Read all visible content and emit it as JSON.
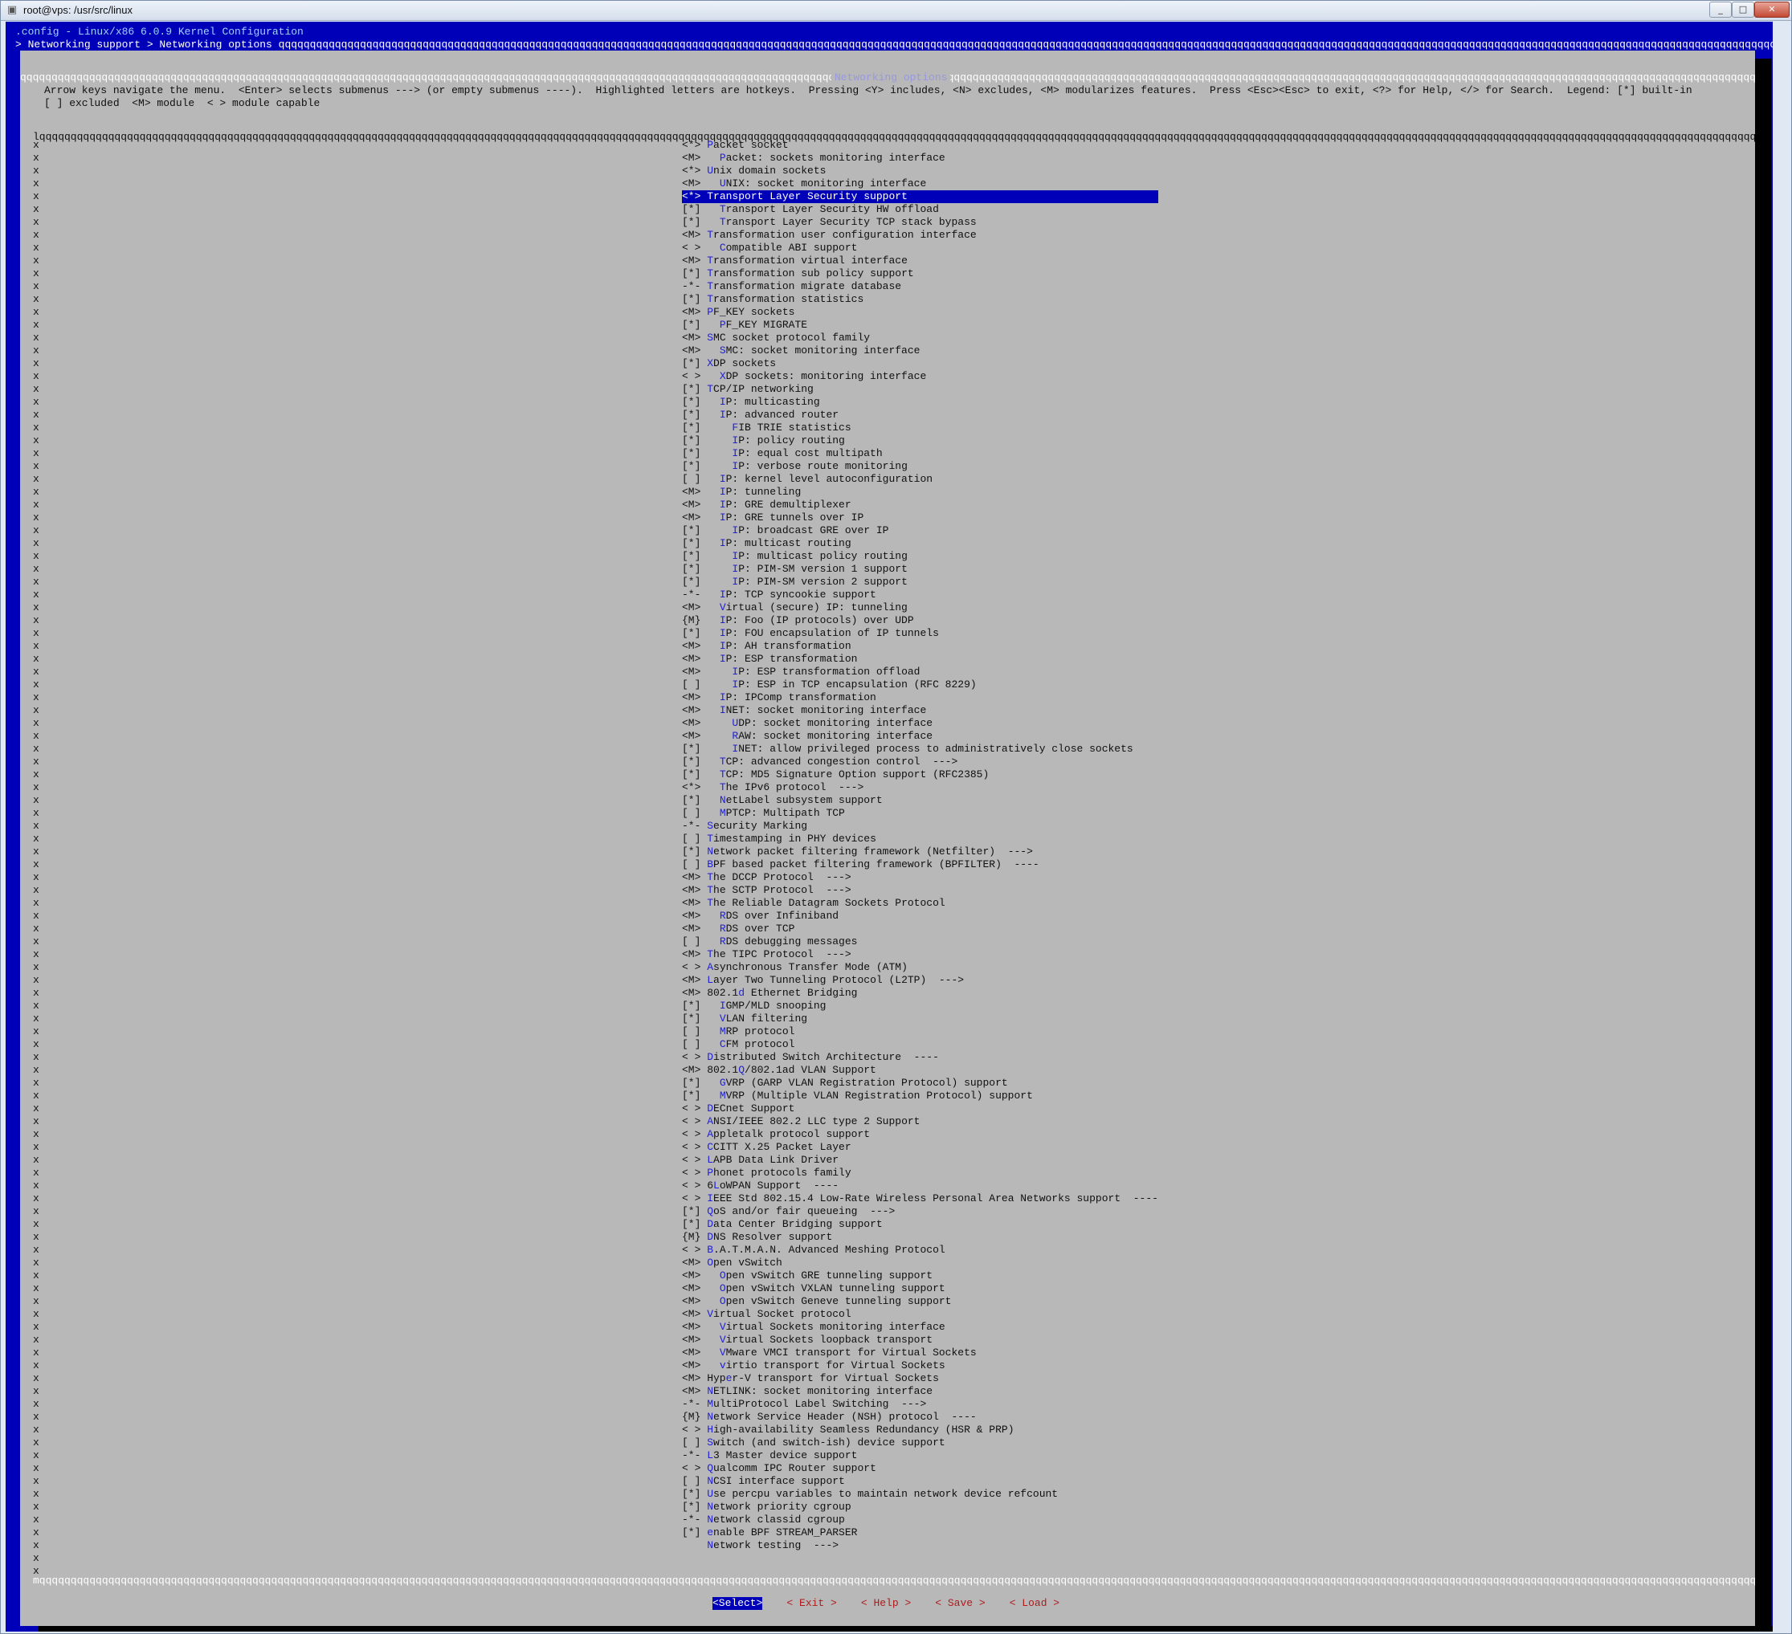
{
  "window": {
    "title": "root@vps: /usr/src/linux",
    "controls": {
      "minimize": "_",
      "maximize": "□",
      "close": "✕"
    }
  },
  "terminal": {
    "header": ".config - Linux/x86 6.0.9 Kernel Configuration",
    "breadcrumb": "> Networking support > Networking options qqqqqqqqqqqqqqqqqqqqqqqqqqqqqqqqqqqqqqqqqqqqqqqqqqqqqqqqqqqqqqqqqqqqqqqqqqqqqqqqqqqqqqqqqqqqqqqqqqqqqqqqqqqqqqqqqqqqqqqqqqqqqqqqqqqqqqqqqqqqqqqqqqqqqqqqqqqqqqqqqqqqqqqqqqqqqqqqqqqqqqqqqqqqqqqqqqqqqqqqqqqqqqqqqqqqqqqqqqqqqqqqqqqqqqqqqqqqqqqqqqqqqqq"
  },
  "dialog": {
    "title": "Networking options",
    "help": "Arrow keys navigate the menu.  <Enter> selects submenus ---> (or empty submenus ----).  Highlighted letters are hotkeys.  Pressing <Y> includes, <N> excludes, <M> modularizes features.  Press <Esc><Esc> to exit, <?> for Help, </> for Search.  Legend: [*] built-in\n[ ] excluded  <M> module  < > module capable",
    "items": [
      {
        "prefix": "<*> ",
        "hot": "P",
        "rest": "acket socket"
      },
      {
        "prefix": "<M>   ",
        "hot": "P",
        "rest": "acket: sockets monitoring interface"
      },
      {
        "prefix": "<*> ",
        "hot": "U",
        "rest": "nix domain sockets"
      },
      {
        "prefix": "<M>   ",
        "hot": "U",
        "rest": "NIX: socket monitoring interface"
      },
      {
        "prefix": "<*> ",
        "hot": "T",
        "rest": "ransport Layer Security support",
        "selected": true
      },
      {
        "prefix": "[*]   ",
        "hot": "T",
        "rest": "ransport Layer Security HW offload"
      },
      {
        "prefix": "[*]   ",
        "hot": "T",
        "rest": "ransport Layer Security TCP stack bypass"
      },
      {
        "prefix": "<M> ",
        "hot": "T",
        "rest": "ransformation user configuration interface"
      },
      {
        "prefix": "< >   ",
        "hot": "C",
        "rest": "ompatible ABI support"
      },
      {
        "prefix": "<M> ",
        "hot": "T",
        "rest": "ransformation virtual interface"
      },
      {
        "prefix": "[*] ",
        "hot": "T",
        "rest": "ransformation sub policy support"
      },
      {
        "prefix": "-*- ",
        "hot": "T",
        "rest": "ransformation migrate database"
      },
      {
        "prefix": "[*] ",
        "hot": "T",
        "rest": "ransformation statistics"
      },
      {
        "prefix": "<M> ",
        "hot": "P",
        "rest": "F_KEY sockets"
      },
      {
        "prefix": "[*]   ",
        "hot": "P",
        "rest": "F_KEY MIGRATE"
      },
      {
        "prefix": "<M> ",
        "hot": "S",
        "rest": "MC socket protocol family"
      },
      {
        "prefix": "<M>   ",
        "hot": "S",
        "rest": "MC: socket monitoring interface"
      },
      {
        "prefix": "[*] ",
        "hot": "X",
        "rest": "DP sockets"
      },
      {
        "prefix": "< >   ",
        "hot": "X",
        "rest": "DP sockets: monitoring interface"
      },
      {
        "prefix": "[*] ",
        "hot": "T",
        "rest": "CP/IP networking"
      },
      {
        "prefix": "[*]   ",
        "hot": "I",
        "rest": "P: multicasting"
      },
      {
        "prefix": "[*]   ",
        "hot": "I",
        "rest": "P: advanced router"
      },
      {
        "prefix": "[*]     ",
        "hot": "F",
        "rest": "IB TRIE statistics"
      },
      {
        "prefix": "[*]     ",
        "hot": "I",
        "rest": "P: policy routing"
      },
      {
        "prefix": "[*]     ",
        "hot": "I",
        "rest": "P: equal cost multipath"
      },
      {
        "prefix": "[*]     ",
        "hot": "I",
        "rest": "P: verbose route monitoring"
      },
      {
        "prefix": "[ ]   ",
        "hot": "I",
        "rest": "P: kernel level autoconfiguration"
      },
      {
        "prefix": "<M>   ",
        "hot": "I",
        "rest": "P: tunneling"
      },
      {
        "prefix": "<M>   ",
        "hot": "I",
        "rest": "P: GRE demultiplexer"
      },
      {
        "prefix": "<M>   ",
        "hot": "I",
        "rest": "P: GRE tunnels over IP"
      },
      {
        "prefix": "[*]     ",
        "hot": "I",
        "rest": "P: broadcast GRE over IP"
      },
      {
        "prefix": "[*]   ",
        "hot": "I",
        "rest": "P: multicast routing"
      },
      {
        "prefix": "[*]     ",
        "hot": "I",
        "rest": "P: multicast policy routing"
      },
      {
        "prefix": "[*]     ",
        "hot": "I",
        "rest": "P: PIM-SM version 1 support"
      },
      {
        "prefix": "[*]     ",
        "hot": "I",
        "rest": "P: PIM-SM version 2 support"
      },
      {
        "prefix": "-*-   ",
        "hot": "I",
        "rest": "P: TCP syncookie support"
      },
      {
        "prefix": "<M>   ",
        "hot": "V",
        "rest": "irtual (secure) IP: tunneling"
      },
      {
        "prefix": "{M}   ",
        "hot": "I",
        "rest": "P: Foo (IP protocols) over UDP"
      },
      {
        "prefix": "[*]   ",
        "hot": "I",
        "rest": "P: FOU encapsulation of IP tunnels"
      },
      {
        "prefix": "<M>   ",
        "hot": "I",
        "rest": "P: AH transformation"
      },
      {
        "prefix": "<M>   ",
        "hot": "I",
        "rest": "P: ESP transformation"
      },
      {
        "prefix": "<M>     ",
        "hot": "I",
        "rest": "P: ESP transformation offload"
      },
      {
        "prefix": "[ ]     ",
        "hot": "I",
        "rest": "P: ESP in TCP encapsulation (RFC 8229)"
      },
      {
        "prefix": "<M>   ",
        "hot": "I",
        "rest": "P: IPComp transformation"
      },
      {
        "prefix": "<M>   ",
        "hot": "I",
        "rest": "NET: socket monitoring interface"
      },
      {
        "prefix": "<M>     ",
        "hot": "U",
        "rest": "DP: socket monitoring interface"
      },
      {
        "prefix": "<M>     ",
        "hot": "R",
        "rest": "AW: socket monitoring interface"
      },
      {
        "prefix": "[*]     ",
        "hot": "I",
        "rest": "NET: allow privileged process to administratively close sockets"
      },
      {
        "prefix": "[*]   ",
        "hot": "T",
        "rest": "CP: advanced congestion control  --->"
      },
      {
        "prefix": "[*]   ",
        "hot": "T",
        "rest": "CP: MD5 Signature Option support (RFC2385)"
      },
      {
        "prefix": "<*>   ",
        "hot": "T",
        "rest": "he IPv6 protocol  --->"
      },
      {
        "prefix": "[*]   ",
        "hot": "N",
        "rest": "etLabel subsystem support"
      },
      {
        "prefix": "[ ]   ",
        "hot": "M",
        "rest": "PTCP: Multipath TCP"
      },
      {
        "prefix": "-*- ",
        "hot": "S",
        "rest": "ecurity Marking"
      },
      {
        "prefix": "[ ] ",
        "hot": "T",
        "rest": "imestamping in PHY devices"
      },
      {
        "prefix": "[*] ",
        "hot": "N",
        "rest": "etwork packet filtering framework (Netfilter)  --->"
      },
      {
        "prefix": "[ ] ",
        "hot": "B",
        "rest": "PF based packet filtering framework (BPFILTER)  ----"
      },
      {
        "prefix": "<M> ",
        "hot": "T",
        "rest": "he DCCP Protocol  --->"
      },
      {
        "prefix": "<M> ",
        "hot": "T",
        "rest": "he SCTP Protocol  --->"
      },
      {
        "prefix": "<M> ",
        "hot": "T",
        "rest": "he Reliable Datagram Sockets Protocol"
      },
      {
        "prefix": "<M>   ",
        "hot": "R",
        "rest": "DS over Infiniband"
      },
      {
        "prefix": "<M>   ",
        "hot": "R",
        "rest": "DS over TCP"
      },
      {
        "prefix": "[ ]   ",
        "hot": "R",
        "rest": "DS debugging messages"
      },
      {
        "prefix": "<M> ",
        "hot": "T",
        "rest": "he TIPC Protocol  --->"
      },
      {
        "prefix": "< > ",
        "hot": "A",
        "rest": "synchronous Transfer Mode (ATM)"
      },
      {
        "prefix": "<M> ",
        "hot": "L",
        "rest": "ayer Two Tunneling Protocol (L2TP)  --->"
      },
      {
        "prefix": "<M> 802.1",
        "hot": "d",
        "rest": " Ethernet Bridging"
      },
      {
        "prefix": "[*]   ",
        "hot": "I",
        "rest": "GMP/MLD snooping"
      },
      {
        "prefix": "[*]   ",
        "hot": "V",
        "rest": "LAN filtering"
      },
      {
        "prefix": "[ ]   ",
        "hot": "M",
        "rest": "RP protocol"
      },
      {
        "prefix": "[ ]   ",
        "hot": "C",
        "rest": "FM protocol"
      },
      {
        "prefix": "< > ",
        "hot": "D",
        "rest": "istributed Switch Architecture  ----"
      },
      {
        "prefix": "<M> 802.1",
        "hot": "Q",
        "rest": "/802.1ad VLAN Support"
      },
      {
        "prefix": "[*]   ",
        "hot": "G",
        "rest": "VRP (GARP VLAN Registration Protocol) support"
      },
      {
        "prefix": "[*]   ",
        "hot": "M",
        "rest": "VRP (Multiple VLAN Registration Protocol) support"
      },
      {
        "prefix": "< > ",
        "hot": "D",
        "rest": "ECnet Support"
      },
      {
        "prefix": "< > ",
        "hot": "A",
        "rest": "NSI/IEEE 802.2 LLC type 2 Support"
      },
      {
        "prefix": "< > ",
        "hot": "A",
        "rest": "ppletalk protocol support"
      },
      {
        "prefix": "< > ",
        "hot": "C",
        "rest": "CITT X.25 Packet Layer"
      },
      {
        "prefix": "< > ",
        "hot": "L",
        "rest": "APB Data Link Driver"
      },
      {
        "prefix": "< > ",
        "hot": "P",
        "rest": "honet protocols family"
      },
      {
        "prefix": "< > 6",
        "hot": "L",
        "rest": "oWPAN Support  ----"
      },
      {
        "prefix": "< > ",
        "hot": "I",
        "rest": "EEE Std 802.15.4 Low-Rate Wireless Personal Area Networks support  ----"
      },
      {
        "prefix": "[*] ",
        "hot": "Q",
        "rest": "oS and/or fair queueing  --->"
      },
      {
        "prefix": "[*] ",
        "hot": "D",
        "rest": "ata Center Bridging support"
      },
      {
        "prefix": "{M} ",
        "hot": "D",
        "rest": "NS Resolver support"
      },
      {
        "prefix": "< > ",
        "hot": "B",
        "rest": ".A.T.M.A.N. Advanced Meshing Protocol"
      },
      {
        "prefix": "<M> ",
        "hot": "O",
        "rest": "pen vSwitch"
      },
      {
        "prefix": "<M>   ",
        "hot": "O",
        "rest": "pen vSwitch GRE tunneling support"
      },
      {
        "prefix": "<M>   ",
        "hot": "O",
        "rest": "pen vSwitch VXLAN tunneling support"
      },
      {
        "prefix": "<M>   ",
        "hot": "O",
        "rest": "pen vSwitch Geneve tunneling support"
      },
      {
        "prefix": "<M> ",
        "hot": "V",
        "rest": "irtual Socket protocol"
      },
      {
        "prefix": "<M>   ",
        "hot": "V",
        "rest": "irtual Sockets monitoring interface"
      },
      {
        "prefix": "<M>   ",
        "hot": "V",
        "rest": "irtual Sockets loopback transport"
      },
      {
        "prefix": "<M>   ",
        "hot": "V",
        "rest": "Mware VMCI transport for Virtual Sockets"
      },
      {
        "prefix": "<M>   ",
        "hot": "v",
        "rest": "irtio transport for Virtual Sockets"
      },
      {
        "prefix": "<M> Hyp",
        "hot": "e",
        "rest": "r-V transport for Virtual Sockets"
      },
      {
        "prefix": "<M> ",
        "hot": "N",
        "rest": "ETLINK: socket monitoring interface"
      },
      {
        "prefix": "-*- ",
        "hot": "M",
        "rest": "ultiProtocol Label Switching  --->"
      },
      {
        "prefix": "{M} ",
        "hot": "N",
        "rest": "etwork Service Header (NSH) protocol  ----"
      },
      {
        "prefix": "< > ",
        "hot": "H",
        "rest": "igh-availability Seamless Redundancy (HSR & PRP)"
      },
      {
        "prefix": "[ ] ",
        "hot": "S",
        "rest": "witch (and switch-ish) device support"
      },
      {
        "prefix": "-*- ",
        "hot": "L",
        "rest": "3 Master device support"
      },
      {
        "prefix": "< > ",
        "hot": "Q",
        "rest": "ualcomm IPC Router support"
      },
      {
        "prefix": "[ ] ",
        "hot": "N",
        "rest": "CSI interface support"
      },
      {
        "prefix": "[*] ",
        "hot": "U",
        "rest": "se percpu variables to maintain network device refcount"
      },
      {
        "prefix": "[*] ",
        "hot": "N",
        "rest": "etwork priority cgroup"
      },
      {
        "prefix": "-*- ",
        "hot": "N",
        "rest": "etwork classid cgroup"
      },
      {
        "prefix": "[*] ",
        "hot": "e",
        "rest": "nable BPF STREAM_PARSER"
      },
      {
        "prefix": "    ",
        "hot": "N",
        "rest": "etwork testing  --->"
      }
    ],
    "buttons": [
      {
        "label": "<Select>",
        "selected": true
      },
      {
        "label": "< Exit >"
      },
      {
        "label": "< Help >"
      },
      {
        "label": "< Save >"
      },
      {
        "label": "< Load >"
      }
    ]
  },
  "colors": {
    "terminal_bg": "#0000b8",
    "dialog_bg": "#b8b8b8",
    "hotkey": "#2020d8",
    "button_text": "#b01a1a",
    "selection_bg": "#0000b8"
  }
}
